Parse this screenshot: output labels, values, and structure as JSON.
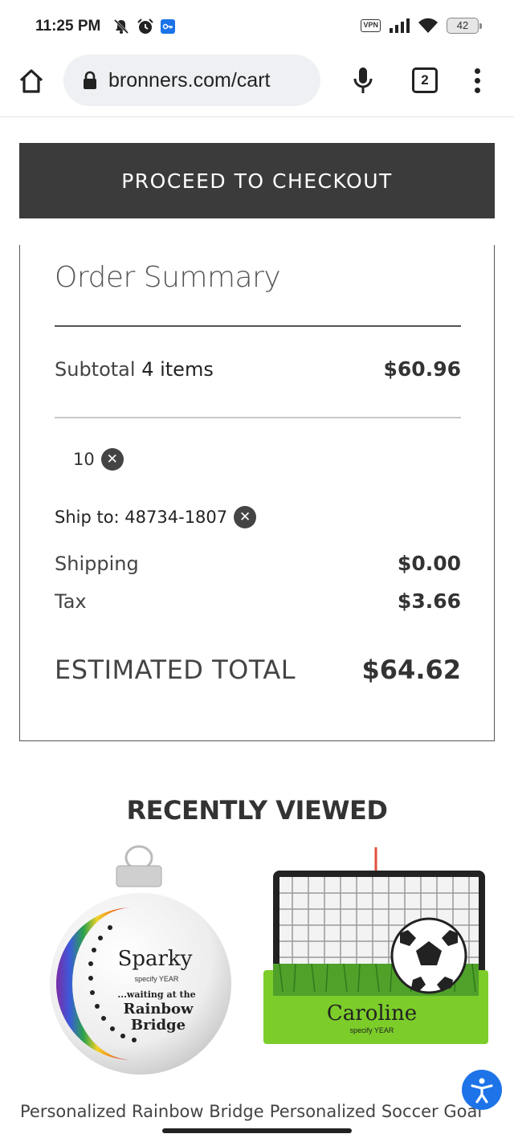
{
  "status_bar": {
    "time": "11:25 PM",
    "icons_left": [
      "mute-icon",
      "alarm-icon",
      "key-icon"
    ],
    "vpn": "VPN",
    "battery": "42"
  },
  "browser": {
    "url": "bronners.com/cart",
    "tab_count": "2"
  },
  "checkout": {
    "label": "PROCEED TO CHECKOUT"
  },
  "order_summary": {
    "title": "Order Summary",
    "subtotal_label": "Subtotal",
    "subtotal_items": "4 items",
    "subtotal_value": "$60.96",
    "coupon_code": "10",
    "ship_to": "Ship to: 48734-1807",
    "shipping_label": "Shipping",
    "shipping_value": "$0.00",
    "tax_label": "Tax",
    "tax_value": "$3.66",
    "total_label": "ESTIMATED TOTAL",
    "total_value": "$64.62"
  },
  "recently_viewed": {
    "title": "RECENTLY VIEWED",
    "products": [
      {
        "name": "Personalized Rainbow Bridge",
        "ornament_text": [
          "Sparky",
          "specify YEAR",
          "...waiting at the",
          "Rainbow",
          "Bridge"
        ]
      },
      {
        "name": "Personalized Soccer Goal",
        "ornament_text": [
          "Caroline",
          "specify YEAR"
        ]
      }
    ]
  },
  "colors": {
    "checkout_bg": "#3b3b3b",
    "accessibility_blue": "#1e73e8",
    "grass_green": "#7ccd2a"
  }
}
